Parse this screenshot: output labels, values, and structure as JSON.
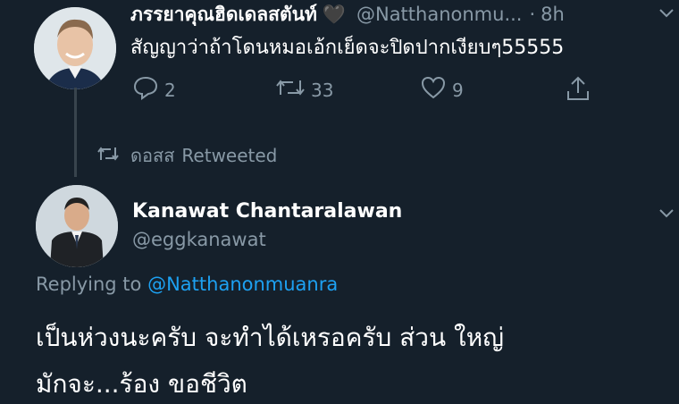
{
  "tweet1": {
    "display_name": "ภรรยาคุณฮิดเดลสตันท์",
    "heart_emoji": "🖤",
    "handle": "@Natthanonmu...",
    "dot": "·",
    "time": "8h",
    "text": "สัญญาว่าถ้าโดนหมอเอ้กเย็ดจะปิดปากเงียบๆ55555",
    "replies": "2",
    "retweets": "33",
    "likes": "9"
  },
  "retweet_notice": {
    "user": "ดอสส",
    "label": "Retweeted"
  },
  "tweet2": {
    "display_name": "Kanawat Chantaralawan",
    "handle": "@eggkanawat",
    "replying_prefix": "Replying to",
    "replying_handle": "@Natthanonmuanra",
    "text_line1": "เป็นห่วงนะครับ จะทำได้เหรอครับ ส่วน ใหญ่",
    "text_line2": "มักจะ...ร้อง ขอชีวิต"
  },
  "colors": {
    "background": "#15202b",
    "link": "#1da1f2",
    "muted": "#8899a6"
  },
  "icons": [
    "reply-icon",
    "retweet-icon",
    "like-icon",
    "share-icon",
    "chevron-down-icon"
  ]
}
